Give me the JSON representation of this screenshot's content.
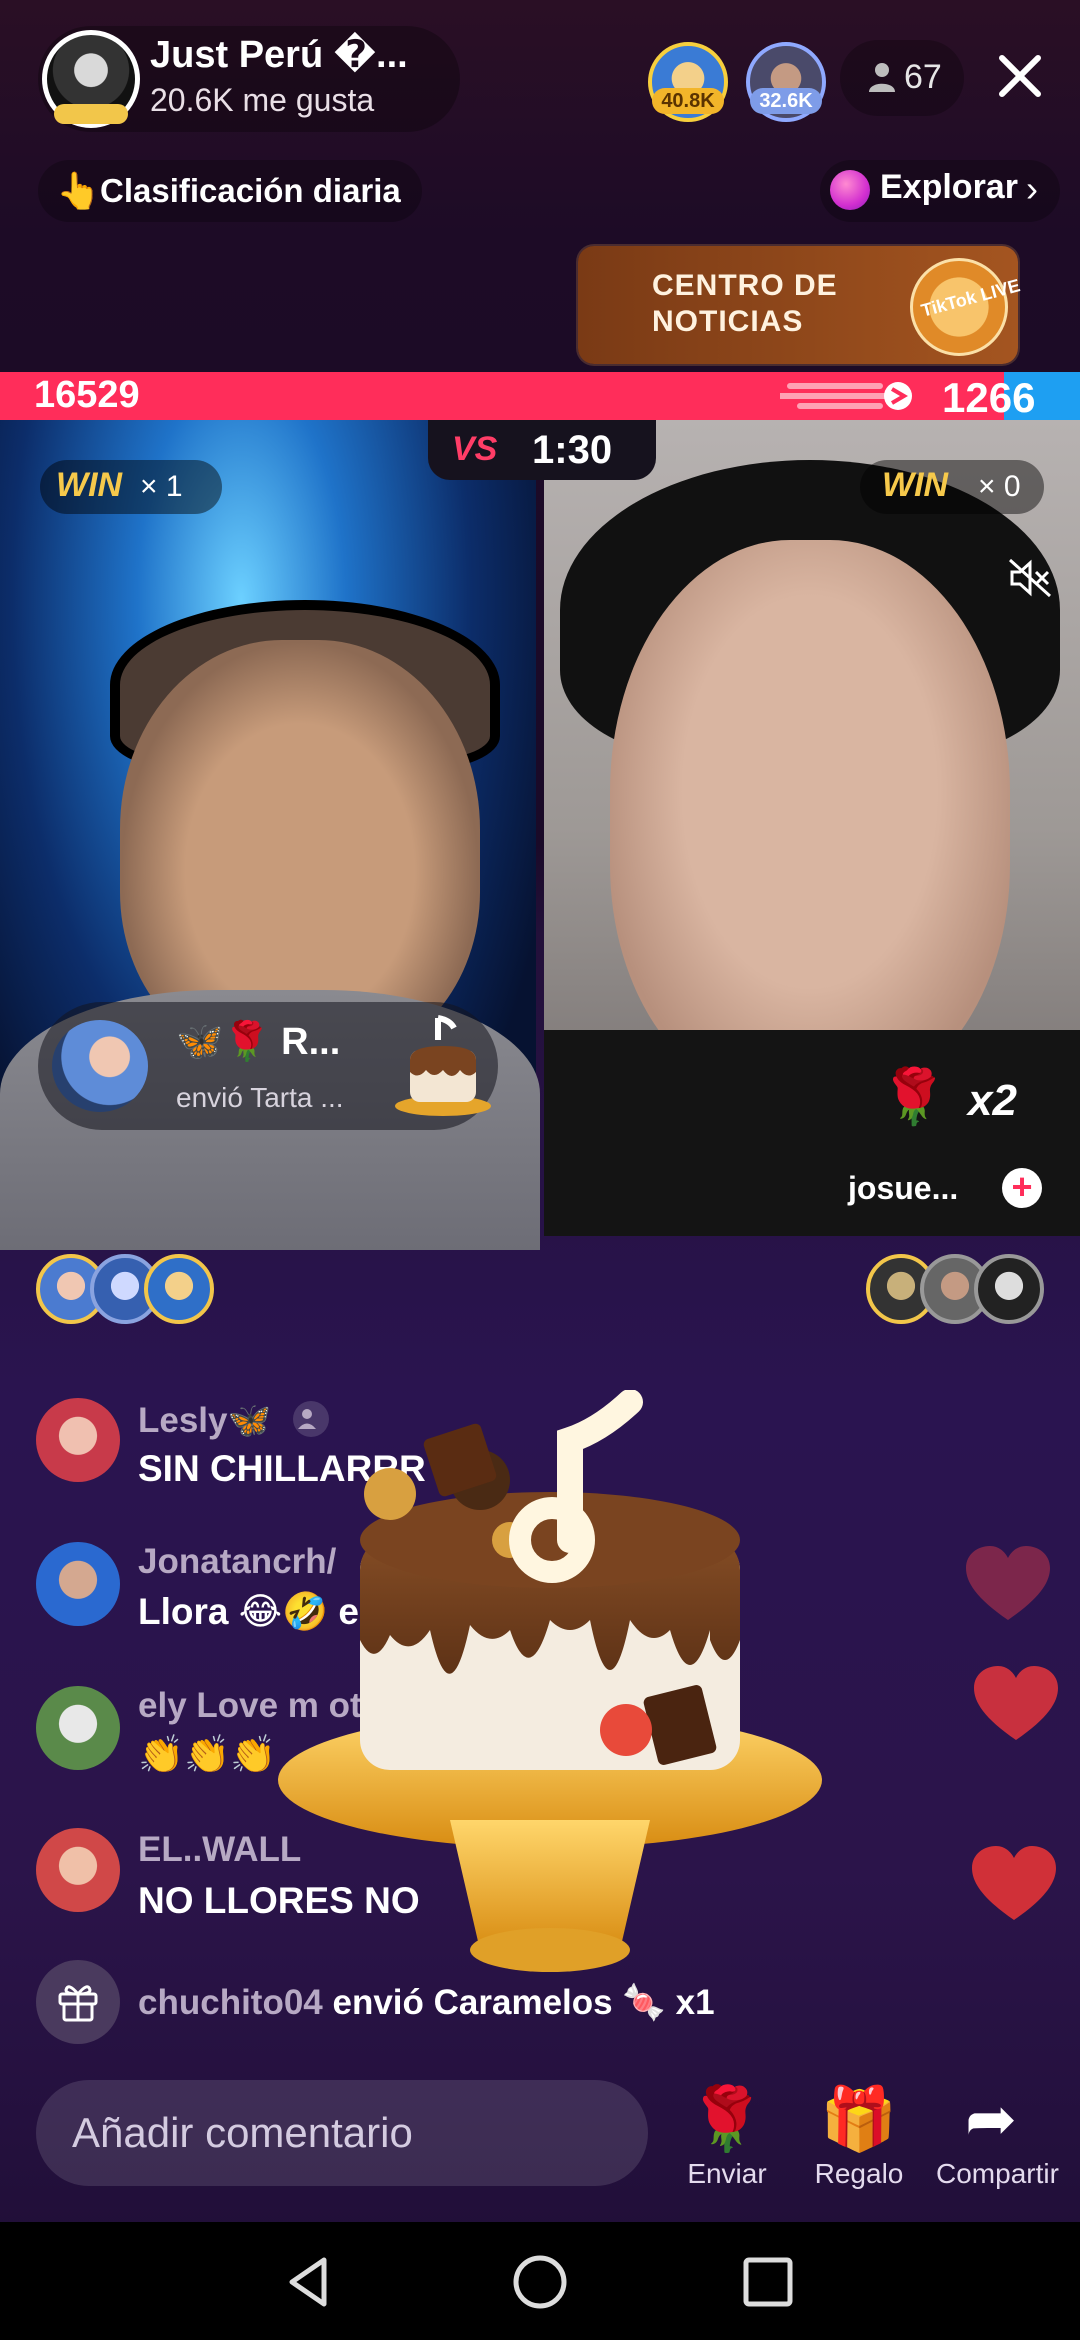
{
  "header": {
    "host_name": "Just Perú �...",
    "likes": "20.6K me gusta",
    "top_viewers": [
      {
        "amount": "40.8K"
      },
      {
        "amount": "32.6K"
      }
    ],
    "viewer_count": "67",
    "close_icon": "close-icon"
  },
  "ranking": {
    "icon": "👆",
    "label": "Clasificación diaria"
  },
  "explore": {
    "label": "Explorar",
    "chevron": "›"
  },
  "news_banner": {
    "text": "CENTRO DE NOTICIAS",
    "logo_text": "TikTok LIVE"
  },
  "battle": {
    "score_left": "16529",
    "score_right": "1266",
    "left_ratio": 0.93,
    "timer": "1:30",
    "vs_label": "VS",
    "left": {
      "win_label": "WIN",
      "win_count": "× 1"
    },
    "right": {
      "win_label": "WIN",
      "win_count": "× 0"
    },
    "colors": {
      "left": "#ff2d5a",
      "right": "#1e9ff2",
      "win": "#f6c94b"
    }
  },
  "gift_toast": {
    "name": "🦋🌹 R...",
    "desc": "envió Tarta ..."
  },
  "right_panel": {
    "rose": "🌹",
    "multiplier": "x2",
    "user": "josue...",
    "add": "+"
  },
  "comments": [
    {
      "user": "Lesly🦋",
      "text": "SIN CHILLARRR"
    },
    {
      "user": "Jonatancrh/",
      "text": "Llora 😂🤣 e"
    },
    {
      "user": "ely Love m ot",
      "text": "👏👏👏"
    },
    {
      "user": "EL..WALL",
      "text": "NO LLORES NO"
    }
  ],
  "gift_event": {
    "user": "chuchito04",
    "text": "envió Caramelos 🍬",
    "count": "x1"
  },
  "bottom": {
    "placeholder": "Añadir comentario",
    "actions": [
      {
        "icon": "🌹",
        "label": "Enviar"
      },
      {
        "icon": "🎁",
        "label": "Regalo"
      },
      {
        "icon": "➦",
        "label": "Compartir"
      }
    ]
  },
  "nav": {
    "back": "◁",
    "home": "○",
    "recents": "□"
  }
}
